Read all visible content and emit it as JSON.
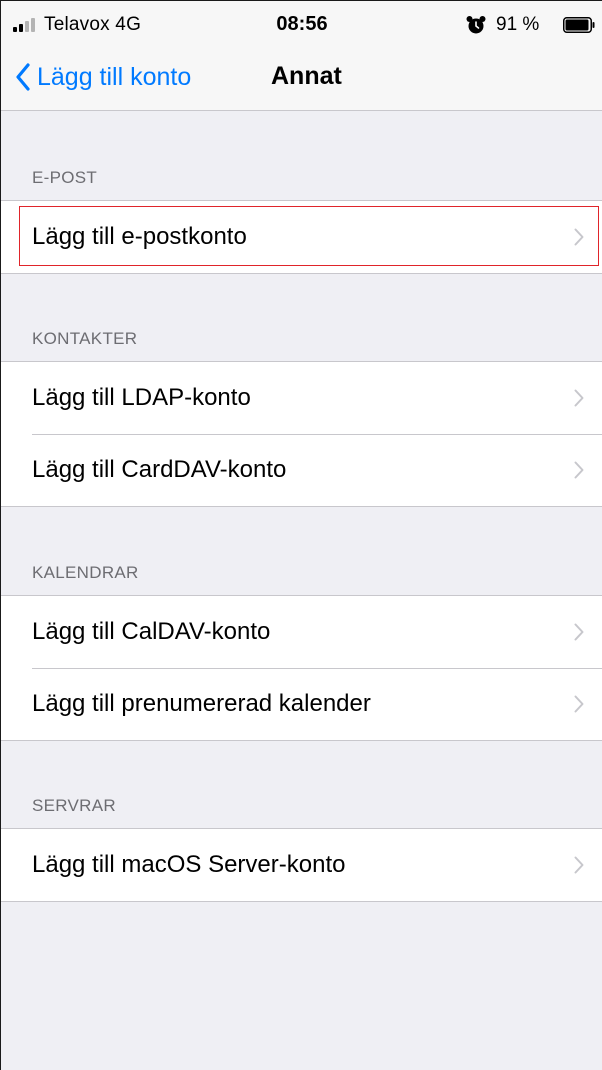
{
  "status_bar": {
    "carrier": "Telavox  4G",
    "time": "08:56",
    "battery_percent": "91 %"
  },
  "nav": {
    "back_label": "Lägg till konto",
    "title": "Annat"
  },
  "sections": [
    {
      "header": "E-POST",
      "rows": [
        "Lägg till e-postkonto"
      ]
    },
    {
      "header": "KONTAKTER",
      "rows": [
        "Lägg till LDAP-konto",
        "Lägg till CardDAV-konto"
      ]
    },
    {
      "header": "KALENDRAR",
      "rows": [
        "Lägg till CalDAV-konto",
        "Lägg till prenumererad kalender"
      ]
    },
    {
      "header": "SERVRAR",
      "rows": [
        "Lägg till macOS Server-konto"
      ]
    }
  ],
  "colors": {
    "accent": "#007aff",
    "background": "#efeff4",
    "highlight_box": "#e0242a"
  },
  "icons": {
    "back": "chevron-left-icon",
    "row_disclosure": "chevron-right-icon",
    "alarm": "alarm-clock-icon",
    "battery": "battery-icon",
    "signal": "signal-strength-icon"
  }
}
